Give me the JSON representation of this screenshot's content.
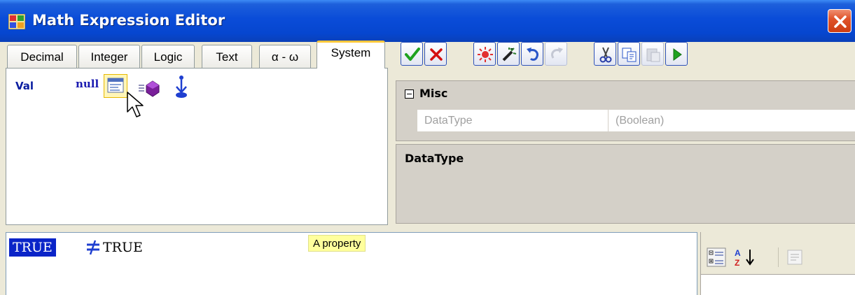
{
  "window": {
    "title": "Math Expression Editor",
    "close_icon": "close-icon"
  },
  "palette": {
    "tabs": [
      {
        "label": "Decimal"
      },
      {
        "label": "Integer"
      },
      {
        "label": "Logic"
      },
      {
        "label": "Text"
      },
      {
        "label": "α - ω"
      },
      {
        "label": "System",
        "active": true
      }
    ],
    "items": {
      "val_label": "Val",
      "null_label": "null"
    },
    "selected_item_icon": "property-icon"
  },
  "toolbar": {
    "buttons": [
      {
        "icon": "check-icon",
        "enabled": true
      },
      {
        "icon": "cancel-icon",
        "enabled": true
      },
      {
        "icon": "sun-icon",
        "enabled": true
      },
      {
        "icon": "magic-wand-icon",
        "enabled": true
      },
      {
        "icon": "undo-icon",
        "enabled": true
      },
      {
        "icon": "redo-icon",
        "enabled": false
      },
      {
        "icon": "cut-icon",
        "enabled": true
      },
      {
        "icon": "copy-icon",
        "enabled": true
      },
      {
        "icon": "paste-icon",
        "enabled": false
      },
      {
        "icon": "run-icon",
        "enabled": true
      }
    ]
  },
  "property_grid": {
    "category": "Misc",
    "property_name": "DataType",
    "property_value": "(Boolean)",
    "description_title": "DataType"
  },
  "expression": {
    "left_operand": "TRUE",
    "right_operand": "TRUE",
    "operator_icon": "not-equal-icon",
    "tooltip": "A property"
  },
  "property_toolbar": {
    "categorized_icon": "categorized-icon",
    "alphabetical_icon": "sort-az-icon",
    "property_pages_icon": "property-pages-icon"
  },
  "colors": {
    "titlebar": "#0A4CD8",
    "selection": "#0A24C8",
    "tooltip_bg": "#FFFF9C",
    "check_green": "#1FA21F",
    "cancel_red": "#D41010"
  }
}
